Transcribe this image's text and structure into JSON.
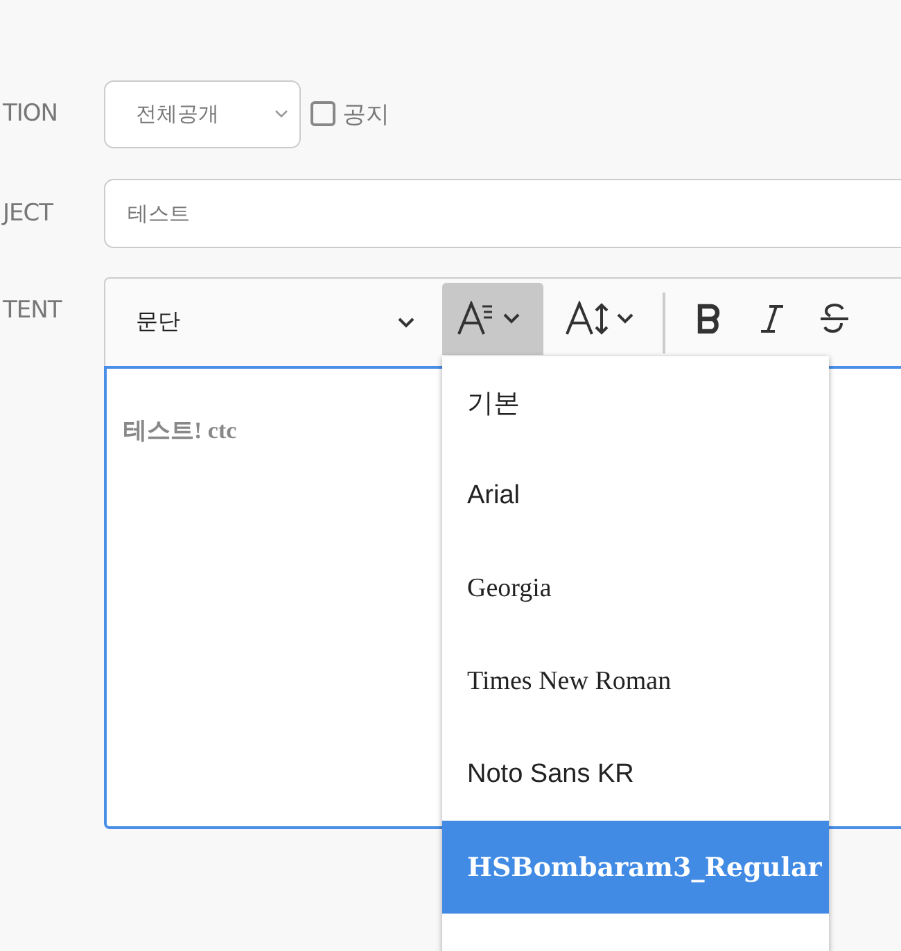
{
  "visibility": {
    "label": "TION",
    "select_value": "전체공개",
    "notice": {
      "label": "공지",
      "checked": false
    }
  },
  "subject": {
    "label": "JECT",
    "value": "테스트"
  },
  "content": {
    "label": "TENT",
    "toolbar": {
      "paragraph_select": "문단",
      "font_active": true
    },
    "body_text": "테스트! ctc",
    "font_menu": [
      {
        "label": "기본",
        "kind": "sans",
        "selected": false
      },
      {
        "label": "Arial",
        "kind": "sans",
        "selected": false
      },
      {
        "label": "Georgia",
        "kind": "serif",
        "selected": false
      },
      {
        "label": "Times New Roman",
        "kind": "serif",
        "selected": false
      },
      {
        "label": "Noto Sans KR",
        "kind": "sans",
        "selected": false
      },
      {
        "label": "HSBombaram3_Regular",
        "kind": "display",
        "selected": true
      }
    ]
  }
}
